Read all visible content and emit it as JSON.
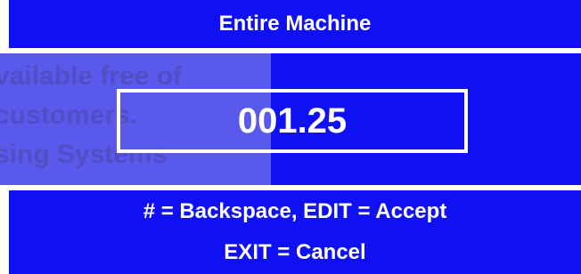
{
  "header": {
    "title": "Entire Machine"
  },
  "background_text": {
    "line1": "vailable free of",
    "line2": "customers.",
    "line3": "sing Systems"
  },
  "value_display": {
    "value": "001.25"
  },
  "footer": {
    "instruction_line1": "# = Backspace, EDIT = Accept",
    "instruction_line2": "EXIT = Cancel"
  },
  "colors": {
    "panel_blue": "#1010f4",
    "text": "#ffffff"
  }
}
